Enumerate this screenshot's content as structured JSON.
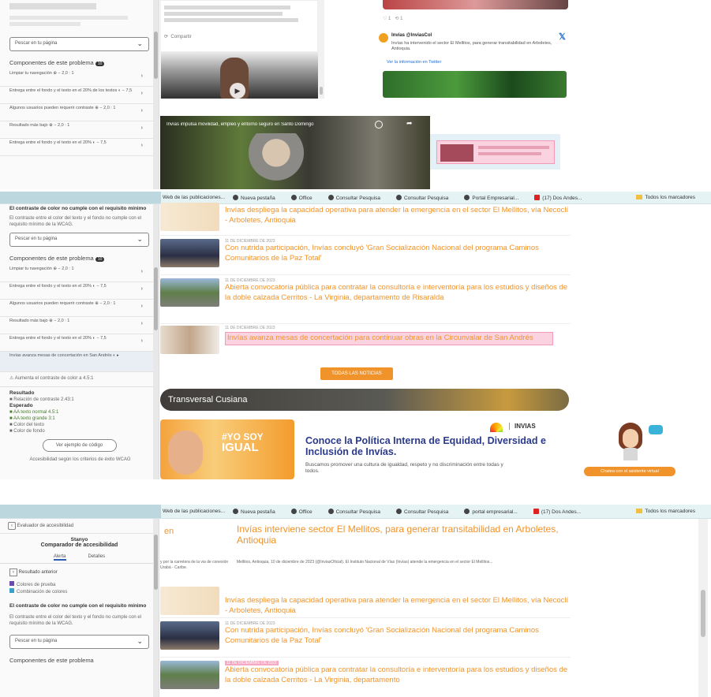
{
  "top_panel": {
    "sidebar": {
      "select_text": "Pescar en tu página",
      "components_heading": "Componentes de este problema",
      "components_badge": "10",
      "rows": [
        "Limpiar tu navegación  ⊕  −  2,0 : 1",
        "Entrega entre el fondo y el texto en el 20% de los textos  ◐  −  7,5",
        "Algunos usuarios pueden requerir contraste  ⊕  −  2,0 : 1",
        "Resultado más bajo  ⊕  −  2,0 : 1",
        "Entrega entre el fondo y el texto en el 20%  ◐  −  7,5"
      ]
    },
    "video_caption": "Invías impulsa movilidad, empleo y entorno seguro en Santo Domingo",
    "tweet_author": "Invías @InviasCol",
    "tweet_text": "Invías ha intervenido el sector El Mellitos, para generar transitabilidad en Arboletes, Antioquia.",
    "tweet_link": "Ver la información en Twitter",
    "share_label": "Compartir"
  },
  "middle_panel": {
    "bookmarks": [
      "Web de las publicaciones...",
      "Nueva pestaña",
      "Office",
      "Consultar Pesquisa",
      "Consultar Pesquisa",
      "Portal Empresarial...",
      "(17) Dos Andes...",
      "Todos los marcadores"
    ],
    "sidebar": {
      "issue_title": "El contraste de color no cumple con el requisito mínimo",
      "issue_desc": "El contraste entre el color del texto y el fondo no cumple con el requisito mínimo de la WCAG.",
      "select_text": "Pescar en tu página",
      "components_heading": "Componentes de este problema",
      "components_badge": "10",
      "rows": [
        "Limpiar tu navegación  ⊕  −  2,0 : 1",
        "Entrega entre el fondo y el texto en el 20%  ◐  −  7,5",
        "Algunos usuarios pueden requerir contraste  ⊕  −  2,0 : 1",
        "Resultado más bajo  ⊕  −  2,0 : 1",
        "Entrega entre el fondo y el texto en el 20%  ◐  −  7,5",
        "Invías avanza mesas de concertación en San Andrés  ◐  ▸"
      ],
      "fix_line": "⚠ Aumenta el contraste de color a 4.5:1",
      "details": [
        "Resultado",
        "■ Relación de contraste 2.43:1",
        "Esperado",
        "■ AA texto normal 4.5:1",
        "■ AA texto grande 3:1",
        "■ Color del texto",
        "■ Color de fondo"
      ],
      "button": "Ver ejemplo de código",
      "footnote": "Accesibilidad según los criterios de éxito WCAG"
    },
    "news": [
      {
        "meta": "",
        "title": "Invías despliega la capacidad operativa para atender la emergencia en el sector El Mellitos, vía Necoclí - Arboletes, Antioquia"
      },
      {
        "meta": "11 de diciembre de 2023",
        "title": "Con nutrida participación, Invías concluyó 'Gran Socialización Nacional del programa Caminos Comunitarios de la Paz Total'"
      },
      {
        "meta": "11 de diciembre de 2023",
        "title": "Abierta convocatoria pública para contratar la consultoría e interventoría para los estudios y diseños de la doble calzada Cerritos - La Virginia, departamento de Risaralda"
      },
      {
        "meta": "11 de diciembre de 2023",
        "title": "Invías avanza mesas de concertación para continuar obras en la Circunvalar de San Andrés"
      }
    ],
    "all_news_button": "TODAS LAS NOTICIAS",
    "banner_title": "Transversal Cusiana",
    "equity": {
      "badge_line1": "#YO SOY",
      "badge_line2": "IGUAL",
      "heading": "Conoce la Política Interna de Equidad, Diversidad e Inclusión de Invías.",
      "body": "Buscamos promover una cultura de igualdad, respeto y no discriminación entre todas y todos.",
      "logo": "INVIAS"
    },
    "chat_button": "Chatea con el asistente virtual"
  },
  "bottom_panel": {
    "bookmarks": [
      "Web de las publicaciones...",
      "Nueva pestaña",
      "Office",
      "Consultar Pesquisa",
      "Consultar Pesquisa",
      "portal empresarial...",
      "(17) Dos Andes...",
      "Todos los marcadores"
    ],
    "sidebar": {
      "ext_name": "Evaluador de accesibilidad",
      "title1": "Stanyo",
      "title2": "Comparador de accesibilidad",
      "tabs": [
        "Alerta",
        "Detalles"
      ],
      "back_label": "Resultado anterior",
      "legend": [
        "Colores de prueba",
        "Combinación de colores"
      ],
      "issue_title": "El contraste de color no cumple con el requisito mínimo",
      "issue_desc": "El contraste entre el color del texto y el fondo no cumple con el requisito mínimo de la WCAG.",
      "select_text": "Pescar en tu página",
      "components_heading": "Componentes de este problema"
    },
    "lead_fragment": "en",
    "headline": "Invías interviene sector El Mellitos, para generar transitabilidad en Arboletes, Antioquia",
    "summary": "Mellitos, Antioquia, 10 de diciembre de 2023 (@InviasOficial). El Instituto Nacional de Vías (Invías) atiende la emergencia en el sector El Mellitos...",
    "left_fragment": "y por la carretera de la via de conexión Urabá - Caribe.",
    "news": [
      {
        "meta": "",
        "title": "Invías despliega la capacidad operativa para atender la emergencia en el sector El Mellitos, vía Necoclí - Arboletes, Antioquia"
      },
      {
        "meta": "11 de diciembre de 2023",
        "title": "Con nutrida participación, Invías concluyó 'Gran Socialización Nacional del programa Caminos Comunitarios de la Paz Total'"
      },
      {
        "meta": "11 de diciembre de 2023",
        "title": "Abierta convocatoria pública para contratar la consultoría e interventoría para los estudios y diseños de la doble calzada Cerritos - La Virginia, departamento"
      }
    ]
  },
  "colors": {
    "accent_orange": "#f0932b",
    "highlight_pink": "#fbd3e0",
    "bookmark_bar": "#e5f3f5"
  }
}
